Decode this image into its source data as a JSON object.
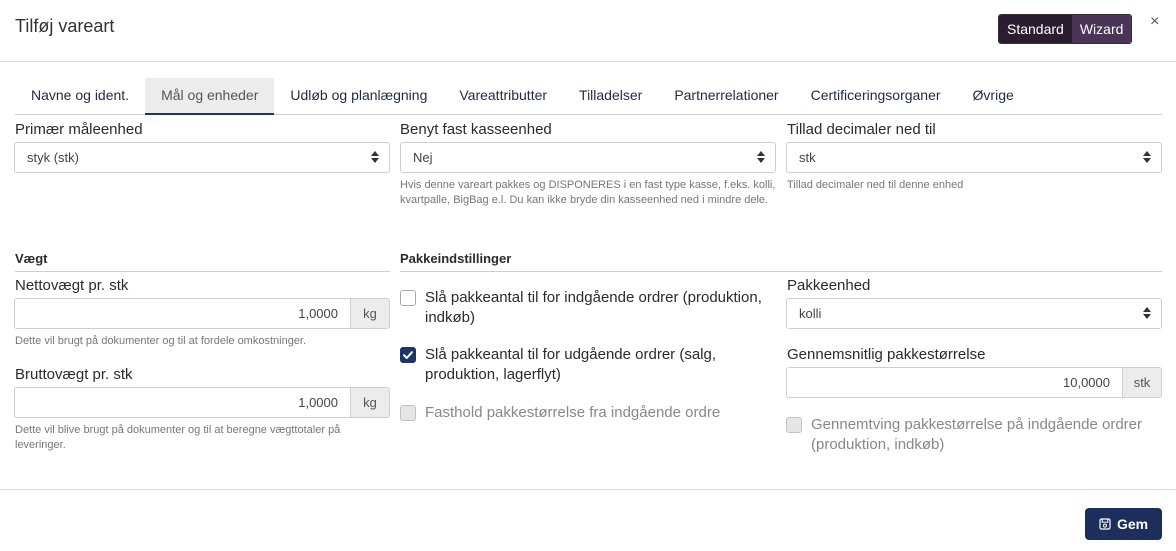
{
  "header": {
    "title": "Tilføj vareart",
    "mode_standard": "Standard",
    "mode_wizard": "Wizard",
    "close": "×"
  },
  "tabs": [
    {
      "label": "Navne og ident."
    },
    {
      "label": "Mål og enheder"
    },
    {
      "label": "Udløb og planlægning"
    },
    {
      "label": "Vareattributter"
    },
    {
      "label": "Tilladelser"
    },
    {
      "label": "Partnerrelationer"
    },
    {
      "label": "Certificeringsorganer"
    },
    {
      "label": "Øvrige"
    }
  ],
  "primary_unit": {
    "label": "Primær måleenhed",
    "value": "styk (stk)"
  },
  "fixed_box": {
    "label": "Benyt fast kasseenhed",
    "value": "Nej",
    "help": "Hvis denne vareart pakkes og DISPONERES i en fast type kasse, f.eks. kolli, kvartpalle, BigBag e.l. Du kan ikke bryde din kasseenhed ned i mindre dele."
  },
  "decimals": {
    "label": "Tillad decimaler ned til",
    "value": "stk",
    "help": "Tillad decimaler ned til denne enhed"
  },
  "weight": {
    "section": "Vægt",
    "net_label": "Nettovægt pr. stk",
    "net_value": "1,0000",
    "net_unit": "kg",
    "net_help": "Dette vil brugt på dokumenter og til at fordele omkostninger.",
    "gross_label": "Bruttovægt pr. stk",
    "gross_value": "1,0000",
    "gross_unit": "kg",
    "gross_help": "Dette vil blive brugt på dokumenter og til at beregne vægttotaler på leveringer."
  },
  "package": {
    "section": "Pakkeindstillinger",
    "incoming_label": "Slå pakkeantal til for indgående ordrer (produktion, indkøb)",
    "incoming_checked": false,
    "outgoing_label": "Slå pakkeantal til for udgående ordrer (salg, produktion, lagerflyt)",
    "outgoing_checked": true,
    "keep_label": "Fasthold pakkestørrelse fra indgående ordre",
    "keep_disabled": true,
    "unit_label": "Pakkeenhed",
    "unit_value": "kolli",
    "avg_label": "Gennemsnitlig pakkestørrelse",
    "avg_value": "10,0000",
    "avg_unit": "stk",
    "enforce_label": "Gennemtving pakkestørrelse på indgående ordrer (produktion, indkøb)",
    "enforce_disabled": true
  },
  "footer": {
    "save_label": "Gem"
  },
  "colors": {
    "primary": "#1c2e5b",
    "mode_dark": "#2a1d30",
    "mode_wizard": "#4b3556"
  }
}
